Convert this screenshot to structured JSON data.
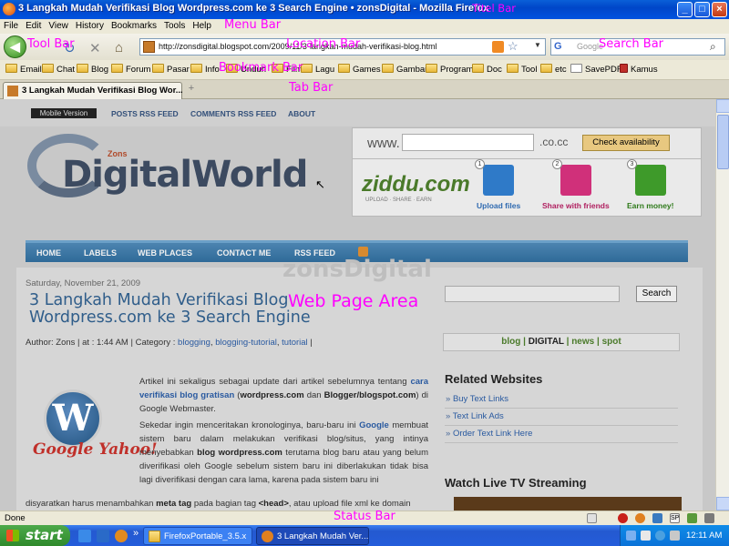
{
  "window": {
    "title": "3 Langkah Mudah Verifikasi Blog Wordpress.com ke 3 Search Engine • zonsDigital - Mozilla Firefox",
    "minimize": "_",
    "maximize": "□",
    "close": "×"
  },
  "menu": [
    "File",
    "Edit",
    "View",
    "History",
    "Bookmarks",
    "Tools",
    "Help"
  ],
  "toolbar": {
    "back": "◀",
    "reload": "↻",
    "stop": "✕",
    "home": "⌂",
    "url": "http://zonsdigital.blogspot.com/2009/11/3-langkah-mudah-verifikasi-blog.html",
    "search_engine": "G",
    "search_placeholder": "Google"
  },
  "bookmarks": [
    "Email",
    "Chat",
    "Blog",
    "Forum",
    "Pasar",
    "Info",
    "Unduh",
    "Film",
    "Lagu",
    "Games",
    "Gambar",
    "Program",
    "Doc",
    "Tool",
    "etc",
    "SavePDF",
    "Kamus"
  ],
  "tabs": [
    {
      "label": "3 Langkah Mudah Verifikasi Blog Wor..."
    }
  ],
  "new_tab": "+",
  "annotations": {
    "title_bar": "Titel Bar",
    "menu_bar": "Menu Bar",
    "tool_bar": "Tool Bar",
    "location_bar": "Location Bar",
    "search_bar": "Search Bar",
    "bookmark_bar": "Bookmark Bar",
    "tab_bar": "Tab Bar",
    "web_page_area": "Web Page Area",
    "status_bar": "Status Bar"
  },
  "page": {
    "mobile": "Mobile Version",
    "topnav": [
      "POSTS RSS FEED",
      "COMMENTS RSS FEED",
      "ABOUT"
    ],
    "logo_main": "DigitalWorld",
    "logo_zons": "Zons",
    "domain": {
      "www": "www.",
      "tld": ".co.cc",
      "button": "Check availability"
    },
    "ziddu": {
      "logo": "ziddu.com",
      "tagline": "UPLOAD · SHARE · EARN",
      "steps": [
        {
          "num": "1",
          "label": "Upload files",
          "color": "#2F7AC8"
        },
        {
          "num": "2",
          "label": "Share with friends",
          "color": "#D0307A"
        },
        {
          "num": "3",
          "label": "Earn money!",
          "color": "#3E9A2A"
        }
      ]
    },
    "mainnav": [
      "HOME",
      "LABELS",
      "WEB PLACES",
      "CONTACT ME",
      "RSS FEED"
    ],
    "watermark": "zonsDigital",
    "date": "Saturday, November 21, 2009",
    "post_title": "3 Langkah Mudah Verifikasi Blog Wordpress.com ke 3 Search Engine",
    "meta": {
      "prefix": "Author: Zons | at : 1:44 AM | Category : ",
      "cat1": "blogging",
      "cat2": "blogging-tutorial",
      "cat3": "tutorial",
      "suffix": " |"
    },
    "image": {
      "logo_letter": "W",
      "caption": "Google Yahoo!"
    },
    "para1": {
      "t1": "Artikel ini sekaligus sebagai update dari artikel sebelumnya tentang ",
      "l1": "cara verifikasi blog gratisan",
      "t2": " (",
      "b1": "wordpress.com",
      "t3": " dan ",
      "b2": "Blogger/blogspot.com",
      "t4": ") di Google Webmaster."
    },
    "para2": {
      "t1": "Sekedar ingin menceritakan kronologinya, baru-baru ini ",
      "l1": "Google",
      "t2": " membuat sistem baru dalam melakukan verifikasi blog/situs, yang intinya menyebabkan ",
      "b1": "blog wordpress.com",
      "t3": " terutama blog baru atau yang belum diverifikasi oleh Google sebelum sistem baru ini diberlakukan tidak bisa lagi diverifikasi dengan cara lama, karena pada sistem baru ini"
    },
    "para3": {
      "t1": "disyaratkan harus menambahkan ",
      "b1": "meta tag",
      "t2": " pada bagian tag ",
      "b2": "<head>",
      "t3": ", atau upload file xml ke domain"
    },
    "sidebar": {
      "search_button": "Search",
      "tags": {
        "blog": "blog",
        "digital": "DIGITAL",
        "news": "news",
        "spot": "spot"
      },
      "related_heading": "Related Websites",
      "related": [
        "Buy Text Links",
        "Text Link Ads",
        "Order Text Link Here"
      ],
      "tv_heading": "Watch Live TV Streaming"
    }
  },
  "status": {
    "text": "Done",
    "sp": "SP"
  },
  "taskbar": {
    "start": "start",
    "more": "»",
    "tasks": [
      "FirefoxPortable_3.5.x",
      "3 Langkah Mudah Ver..."
    ],
    "clock": "12:11 AM"
  }
}
